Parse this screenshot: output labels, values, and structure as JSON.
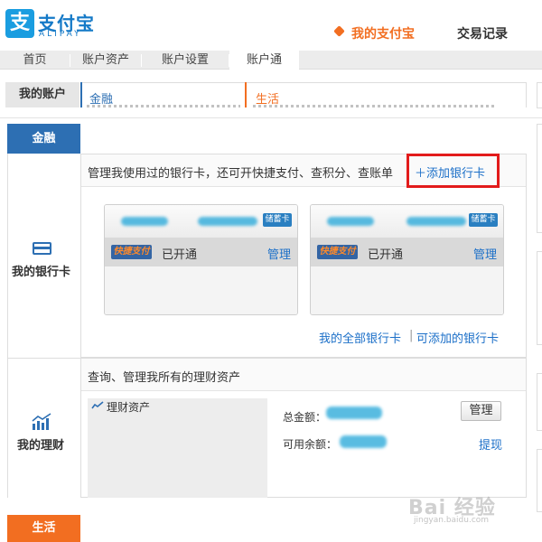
{
  "brand": {
    "mark": "支",
    "name_cn": "支付宝",
    "name_en": "ALIPAY",
    "color": "#1479c7"
  },
  "topnav": {
    "active": "我的支付宝",
    "trade": "交易记录",
    "accent": "#f26e21"
  },
  "subnav": {
    "items": [
      "首页",
      "账户资产",
      "账户设置",
      "账户通"
    ]
  },
  "account": {
    "label": "我的账户",
    "finance": "金融",
    "life": "生活"
  },
  "tabs": {
    "finance": "金融",
    "life": "生活"
  },
  "bank_cards": {
    "side_label": "我的银行卡",
    "side_icon": "bank-card-icon",
    "heading": "管理我使用过的银行卡，还可开快捷支付、查积分、查账单",
    "add_link": "＋添加银行卡",
    "cards": [
      {
        "badge": "储蓄卡",
        "express": "快捷支付",
        "status": "已开通",
        "manage": "管理"
      },
      {
        "badge": "储蓄卡",
        "express": "快捷支付",
        "status": "已开通",
        "manage": "管理"
      }
    ],
    "all_cards_link": "我的全部银行卡",
    "separator": "|",
    "addable_link": "可添加的银行卡"
  },
  "wealth": {
    "side_label": "我的理财",
    "side_icon": "trend-chart-icon",
    "heading": "查询、管理我所有的理财资产",
    "assets_title": "理财资产",
    "total_label": "总金额：",
    "available_label": "可用余额：",
    "manage_button": "管理",
    "withdraw_link": "提现"
  },
  "watermark": {
    "text": "Bai 经验",
    "url": "jingyan.baidu.com"
  }
}
